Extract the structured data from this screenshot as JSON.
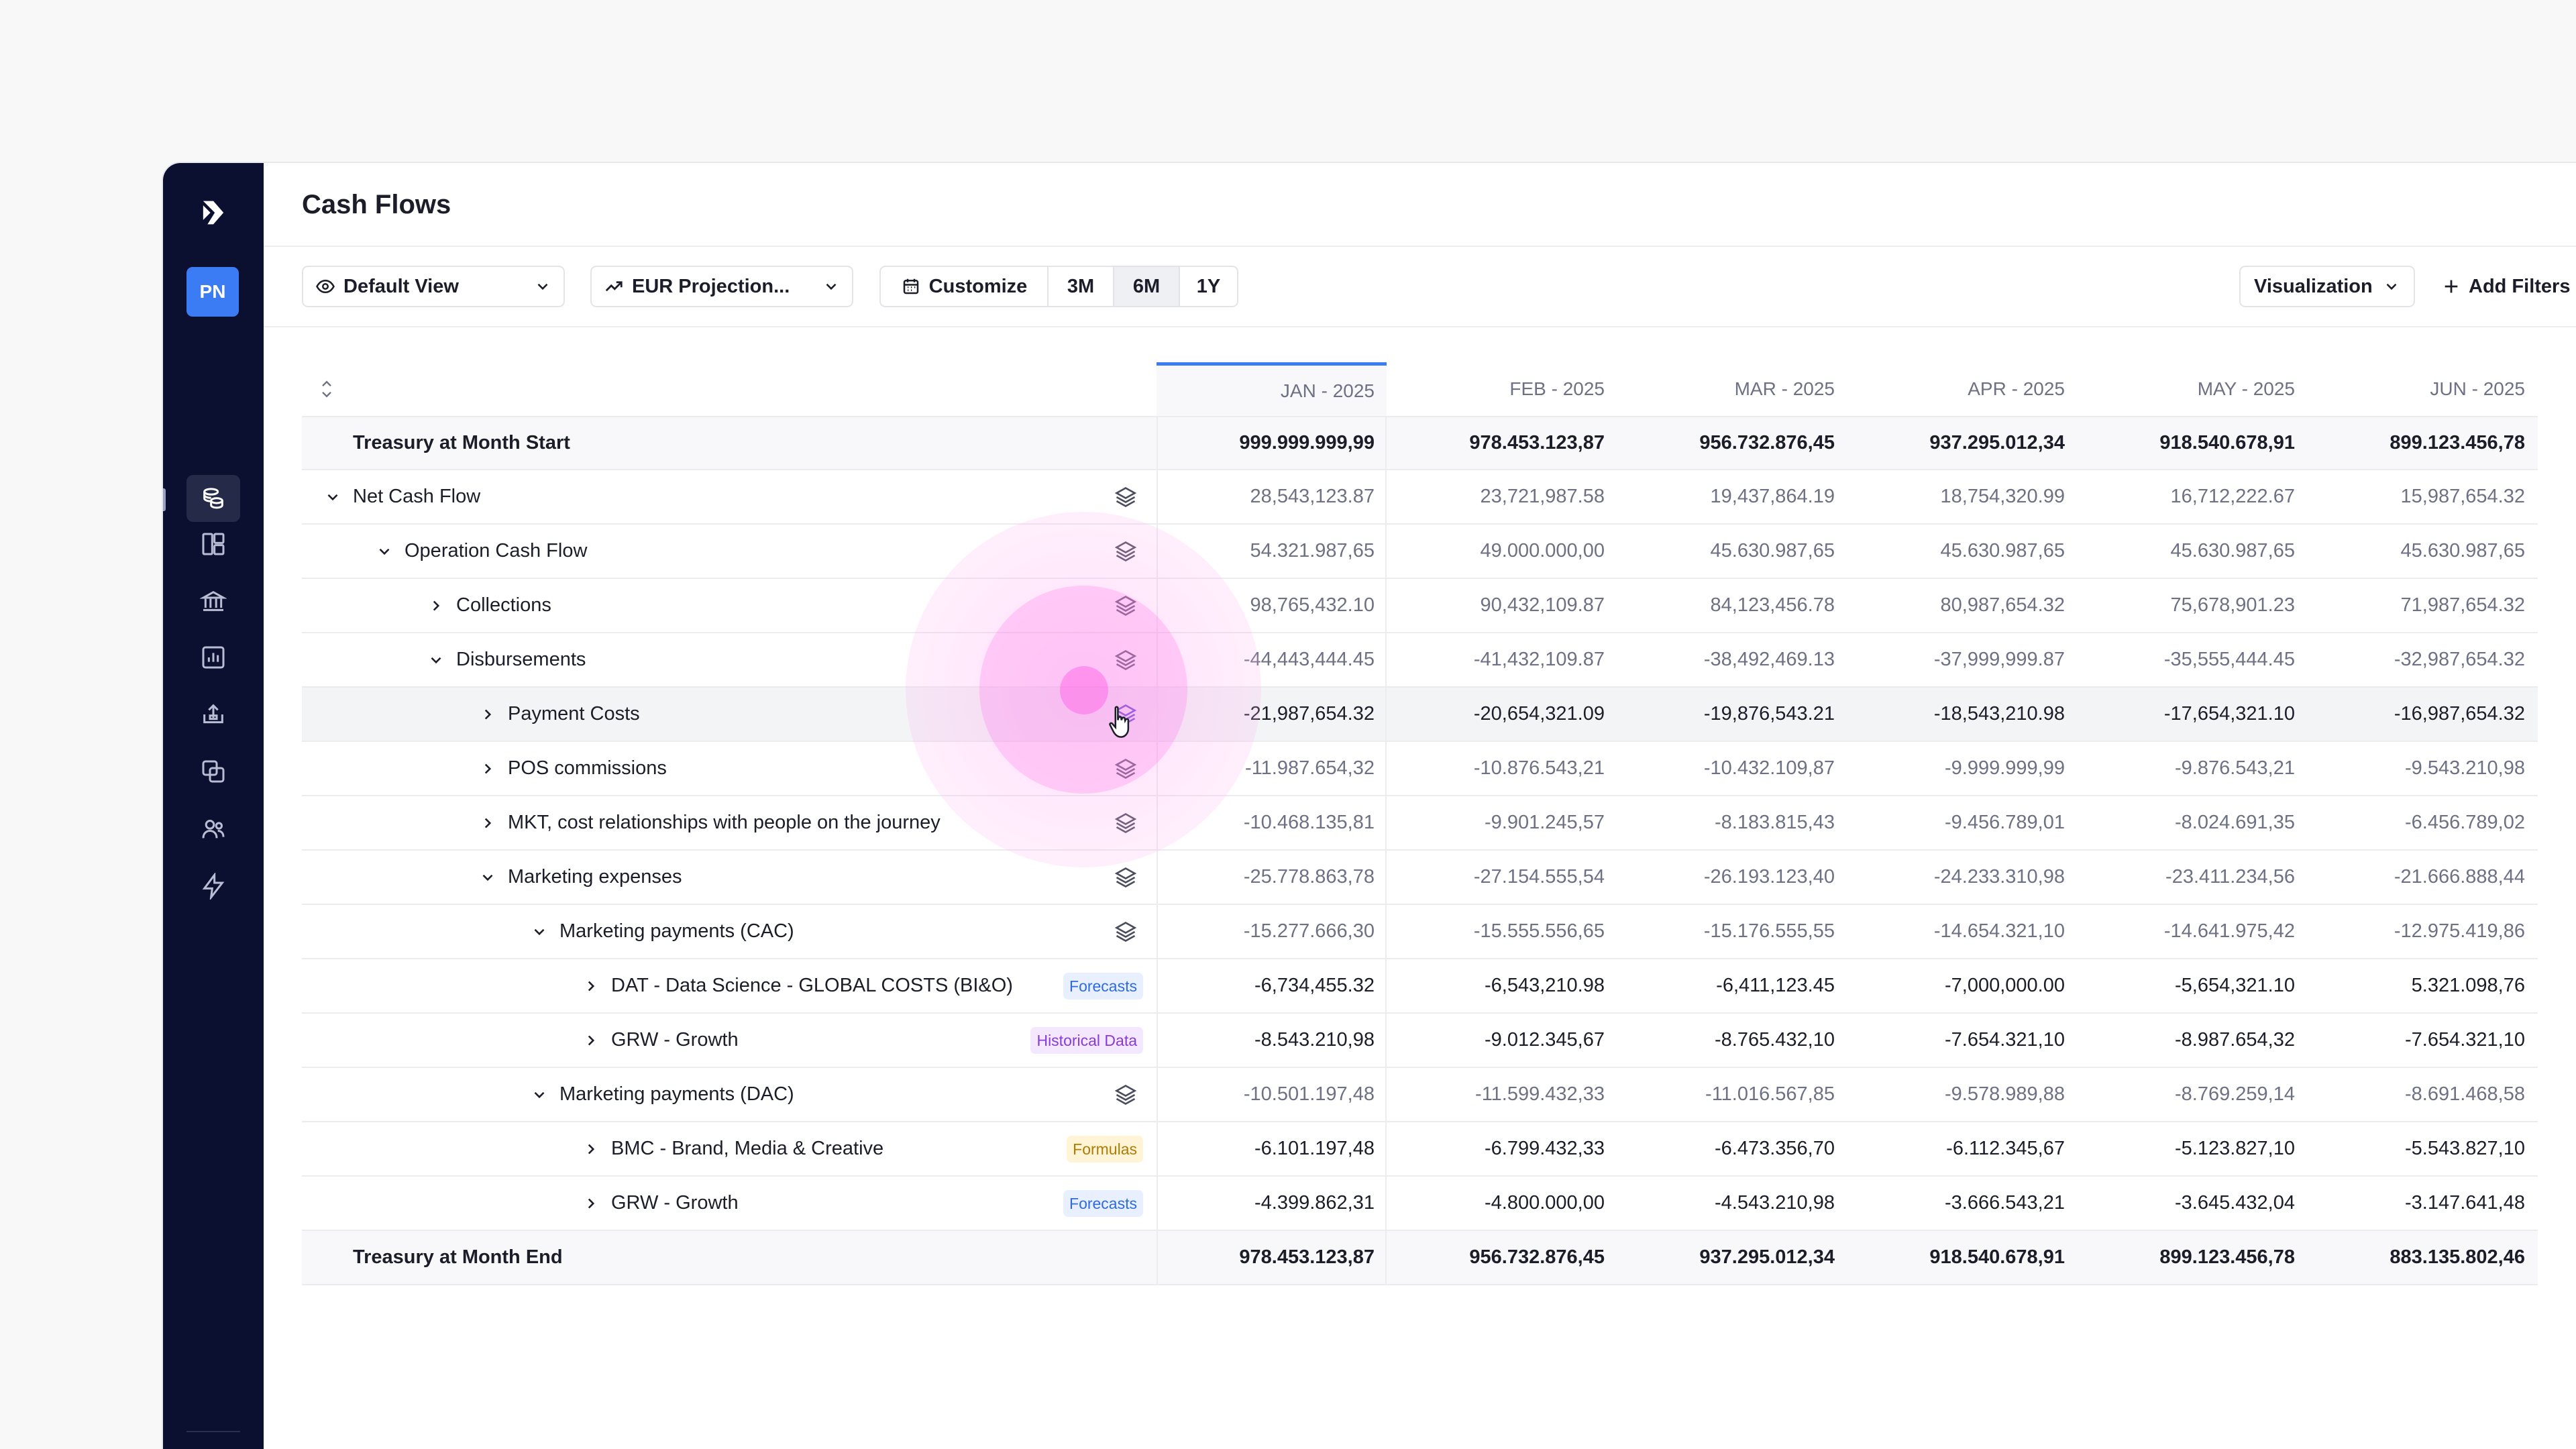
{
  "page": {
    "title": "Cash Flows"
  },
  "sidebar": {
    "avatar_initials": "PN",
    "items": [
      {
        "name": "dashboard",
        "icon": "dashboard-icon"
      },
      {
        "name": "bank",
        "icon": "bank-icon"
      },
      {
        "name": "cash-flows",
        "icon": "coins-icon",
        "active": true
      },
      {
        "name": "reports",
        "icon": "bar-chart-icon"
      },
      {
        "name": "upload",
        "icon": "upload-icon"
      },
      {
        "name": "copy",
        "icon": "copy-icon"
      },
      {
        "name": "users",
        "icon": "users-icon"
      },
      {
        "name": "automations",
        "icon": "lightning-icon"
      }
    ]
  },
  "toolbar": {
    "view_label": "Default View",
    "projection_label": "EUR Projection...",
    "customize_label": "Customize",
    "ranges": [
      "3M",
      "6M",
      "1Y"
    ],
    "selected_range": "6M",
    "visualization_label": "Visualization",
    "add_filters_label": "Add Filters"
  },
  "table": {
    "columns": [
      "JAN - 2025",
      "FEB - 2025",
      "MAR - 2025",
      "APR - 2025",
      "MAY - 2025",
      "JUN - 2025"
    ],
    "rows": [
      {
        "label": "Treasury at Month Start",
        "level": 0,
        "type": "total",
        "values": [
          "999.999.999,99",
          "978.453.123,87",
          "956.732.876,45",
          "937.295.012,34",
          "918.540.678,91",
          "899.123.456,78"
        ]
      },
      {
        "label": "Net Cash Flow",
        "level": 0,
        "chevron": "down",
        "layers": true,
        "values": [
          "28,543,123.87",
          "23,721,987.58",
          "19,437,864.19",
          "18,754,320.99",
          "16,712,222.67",
          "15,987,654.32"
        ]
      },
      {
        "label": "Operation Cash Flow",
        "level": 1,
        "chevron": "down",
        "layers": true,
        "values": [
          "54.321.987,65",
          "49.000.000,00",
          "45.630.987,65",
          "45.630.987,65",
          "45.630.987,65",
          "45.630.987,65"
        ]
      },
      {
        "label": "Collections",
        "level": 2,
        "chevron": "right",
        "layers": true,
        "values": [
          "98,765,432.10",
          "90,432,109.87",
          "84,123,456.78",
          "80,987,654.32",
          "75,678,901.23",
          "71,987,654.32"
        ]
      },
      {
        "label": "Disbursements",
        "level": 2,
        "chevron": "down",
        "layers": true,
        "values": [
          "-44,443,444.45",
          "-41,432,109.87",
          "-38,492,469.13",
          "-37,999,999.87",
          "-35,555,444.45",
          "-32,987,654.32"
        ]
      },
      {
        "label": "Payment Costs",
        "level": 3,
        "chevron": "right",
        "layers": true,
        "highlight": true,
        "values": [
          "-21,987,654.32",
          "-20,654,321.09",
          "-19,876,543.21",
          "-18,543,210.98",
          "-17,654,321.10",
          "-16,987,654.32"
        ]
      },
      {
        "label": "POS commissions",
        "level": 3,
        "chevron": "right",
        "layers": true,
        "values": [
          "-11.987.654,32",
          "-10.876.543,21",
          "-10.432.109,87",
          "-9.999.999,99",
          "-9.876.543,21",
          "-9.543.210,98"
        ]
      },
      {
        "label": "MKT, cost relationships with people on the journey",
        "level": 3,
        "chevron": "right",
        "layers": true,
        "values": [
          "-10.468.135,81",
          "-9.901.245,57",
          "-8.183.815,43",
          "-9.456.789,01",
          "-8.024.691,35",
          "-6.456.789,02"
        ]
      },
      {
        "label": "Marketing expenses",
        "level": 3,
        "chevron": "down",
        "layers": true,
        "values": [
          "-25.778.863,78",
          "-27.154.555,54",
          "-26.193.123,40",
          "-24.233.310,98",
          "-23.411.234,56",
          "-21.666.888,44"
        ]
      },
      {
        "label": "Marketing payments (CAC)",
        "level": 4,
        "chevron": "down",
        "layers": true,
        "values": [
          "-15.277.666,30",
          "-15.555.556,65",
          "-15.176.555,55",
          "-14.654.321,10",
          "-14.641.975,42",
          "-12.975.419,86"
        ]
      },
      {
        "label": "DAT - Data Science - GLOBAL COSTS (BI&O)",
        "level": 5,
        "chevron": "right",
        "badge": "Forecasts",
        "badge_type": "forecast",
        "values": [
          "-6,734,455.32",
          "-6,543,210.98",
          "-6,411,123.45",
          "-7,000,000.00",
          "-5,654,321.10",
          "5.321.098,76"
        ]
      },
      {
        "label": "GRW - Growth",
        "level": 5,
        "chevron": "right",
        "badge": "Historical Data",
        "badge_type": "historical",
        "values": [
          "-8.543.210,98",
          "-9.012.345,67",
          "-8.765.432,10",
          "-7.654.321,10",
          "-8.987.654,32",
          "-7.654.321,10"
        ]
      },
      {
        "label": "Marketing payments (DAC)",
        "level": 4,
        "chevron": "down",
        "layers": true,
        "values": [
          "-10.501.197,48",
          "-11.599.432,33",
          "-11.016.567,85",
          "-9.578.989,88",
          "-8.769.259,14",
          "-8.691.468,58"
        ]
      },
      {
        "label": "BMC - Brand, Media & Creative",
        "level": 5,
        "chevron": "right",
        "badge": "Formulas",
        "badge_type": "formula",
        "values": [
          "-6.101.197,48",
          "-6.799.432,33",
          "-6.473.356,70",
          "-6.112.345,67",
          "-5.123.827,10",
          "-5.543.827,10"
        ]
      },
      {
        "label": "GRW - Growth",
        "level": 5,
        "chevron": "right",
        "badge": "Forecasts",
        "badge_type": "forecast",
        "values": [
          "-4.399.862,31",
          "-4.800.000,00",
          "-4.543.210,98",
          "-3.666.543,21",
          "-3.645.432,04",
          "-3.147.641,48"
        ]
      },
      {
        "label": "Treasury at Month End",
        "level": 0,
        "type": "total",
        "values": [
          "978.453.123,87",
          "956.732.876,45",
          "937.295.012,34",
          "918.540.678,91",
          "899.123.456,78",
          "883.135.802,46"
        ]
      }
    ]
  },
  "colors": {
    "sidebar_bg": "#0c1030",
    "accent": "#3b7cf5",
    "click_ripple": "#ff78eb"
  }
}
